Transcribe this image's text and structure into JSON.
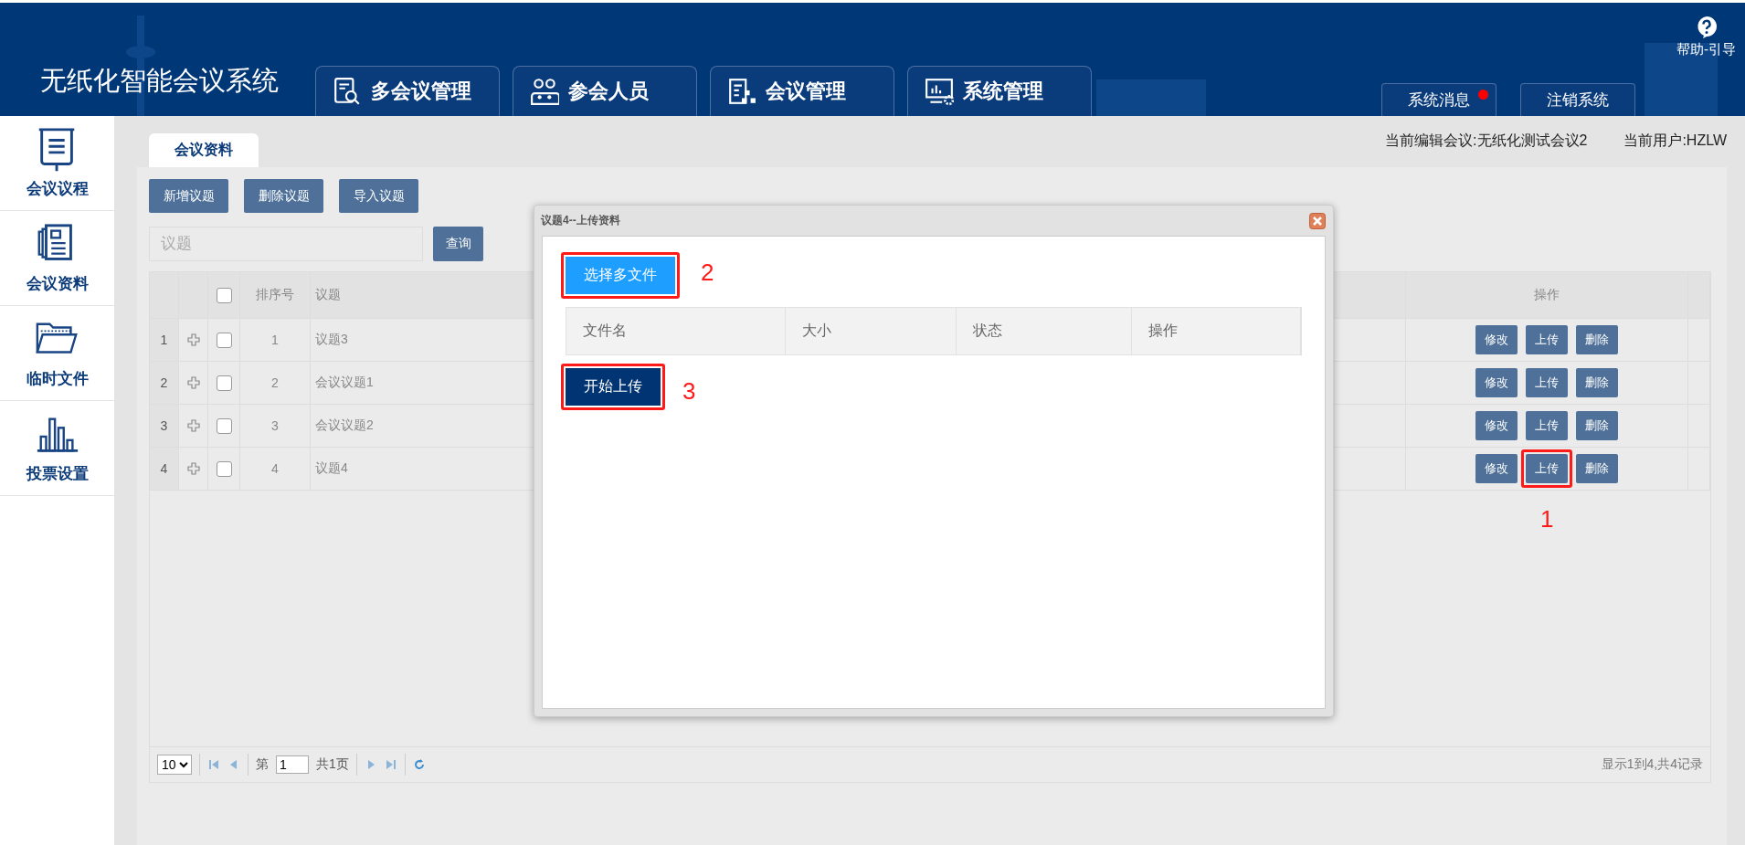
{
  "header": {
    "title": "无纸化智能会议系统",
    "nav": [
      {
        "label": "多会议管理"
      },
      {
        "label": "参会人员"
      },
      {
        "label": "会议管理"
      },
      {
        "label": "系统管理"
      }
    ],
    "help": "帮助-引导",
    "links": [
      {
        "label": "系统消息",
        "unread": true
      },
      {
        "label": "注销系统",
        "unread": false
      }
    ]
  },
  "sidebar": {
    "items": [
      {
        "label": "会议议程"
      },
      {
        "label": "会议资料"
      },
      {
        "label": "临时文件"
      },
      {
        "label": "投票设置"
      }
    ]
  },
  "tabs": [
    {
      "label": "会议资料",
      "selected": true
    }
  ],
  "context": {
    "meeting": "当前编辑会议:无纸化测试会议2",
    "user": "当前用户:HZLW"
  },
  "toolbar": [
    "新增议题",
    "删除议题",
    "导入议题"
  ],
  "search": {
    "placeholder": "议题",
    "button": "查询"
  },
  "table": {
    "header_checked": false,
    "columns": [
      "排序号",
      "议题",
      "操作"
    ],
    "rows": [
      {
        "index": "1",
        "order": "1",
        "topic": "议题3",
        "checked": false,
        "actions": [
          {
            "label": "修改",
            "highlighted": false
          },
          {
            "label": "上传",
            "highlighted": false
          },
          {
            "label": "删除",
            "highlighted": false
          }
        ]
      },
      {
        "index": "2",
        "order": "2",
        "topic": "会议议题1",
        "checked": false,
        "actions": [
          {
            "label": "修改",
            "highlighted": false
          },
          {
            "label": "上传",
            "highlighted": false
          },
          {
            "label": "删除",
            "highlighted": false
          }
        ]
      },
      {
        "index": "3",
        "order": "3",
        "topic": "会议议题2",
        "checked": false,
        "actions": [
          {
            "label": "修改",
            "highlighted": false
          },
          {
            "label": "上传",
            "highlighted": false
          },
          {
            "label": "删除",
            "highlighted": false
          }
        ]
      },
      {
        "index": "4",
        "order": "4",
        "topic": "议题4",
        "checked": false,
        "actions": [
          {
            "label": "修改",
            "highlighted": false
          },
          {
            "label": "上传",
            "highlighted": true,
            "annotation": "1"
          },
          {
            "label": "删除",
            "highlighted": false
          }
        ]
      }
    ]
  },
  "pagination": {
    "page_size": "10",
    "page_prefix": "第",
    "page": "1",
    "page_total": "共1页",
    "summary": "显示1到4,共4记录"
  },
  "dialog": {
    "title": "议题4--上传资料",
    "select_button": {
      "label": "选择多文件",
      "highlighted": true,
      "annotation": "2"
    },
    "columns": [
      "文件名",
      "大小",
      "状态",
      "操作"
    ],
    "start_button": {
      "label": "开始上传",
      "highlighted": true,
      "annotation": "3"
    }
  }
}
